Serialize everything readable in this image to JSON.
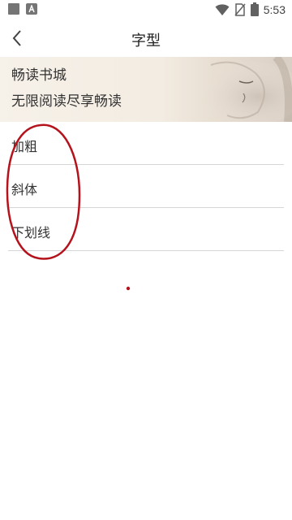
{
  "status_bar": {
    "time": "5:53",
    "icons": [
      "notification-square-icon",
      "app-notification-icon",
      "wifi-icon",
      "no-sim-icon",
      "battery-icon"
    ]
  },
  "header": {
    "title": "字型",
    "back_icon": "chevron-left-icon"
  },
  "banner": {
    "line1": "畅读书城",
    "line2": "无限阅读尽享畅读"
  },
  "options": [
    {
      "label": "加粗"
    },
    {
      "label": "斜体"
    },
    {
      "label": "下划线"
    }
  ],
  "colors": {
    "annotation": "#b5131c",
    "divider": "#d6d6d6",
    "banner_bg": "#f3ece2"
  }
}
